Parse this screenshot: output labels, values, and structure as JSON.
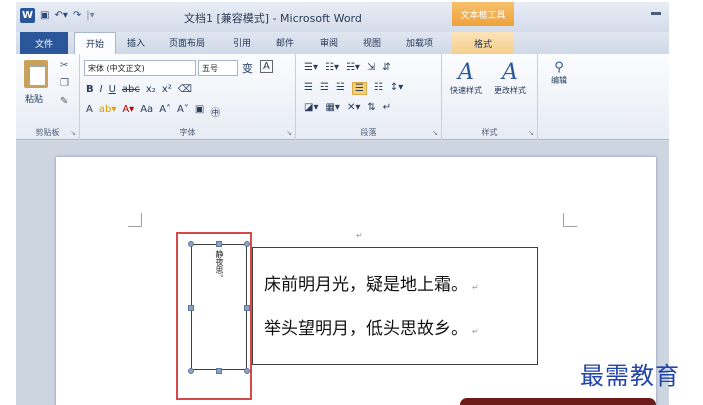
{
  "window": {
    "title": "文档1 [兼容模式] - Microsoft Word",
    "contextual_tab": "文本框工具"
  },
  "tabs": [
    "文件",
    "开始",
    "插入",
    "页面布局",
    "引用",
    "邮件",
    "审阅",
    "视图",
    "加载项",
    "格式"
  ],
  "ribbon": {
    "clipboard": {
      "paste_label": "粘贴",
      "group_label": "剪贴板"
    },
    "font": {
      "font_name": "宋体 (中文正文)",
      "font_size": "五号",
      "group_label": "字体"
    },
    "paragraph": {
      "group_label": "段落"
    },
    "styles": {
      "quick_styles": "快速样式",
      "change_styles": "更改样式",
      "group_label": "样式"
    },
    "editing": {
      "label": "编辑"
    }
  },
  "document": {
    "vertical_text": "静夜思。",
    "poem_lines": [
      "床前明月光，疑是地上霜。",
      "举头望明月，低头思故乡。"
    ]
  },
  "watermark": "最需教育"
}
